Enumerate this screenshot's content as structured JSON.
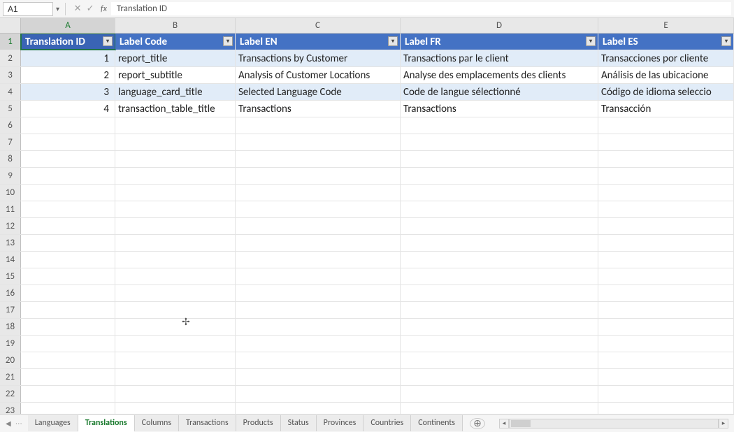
{
  "namebox": "A1",
  "formula_bar": "Translation ID",
  "columns": [
    "A",
    "B",
    "C",
    "D",
    "E"
  ],
  "selected_column": "A",
  "selected_row": 1,
  "row_numbers": [
    1,
    2,
    3,
    4,
    5,
    6,
    7,
    8,
    9,
    10,
    11,
    12,
    13,
    14,
    15,
    16,
    17,
    18,
    19,
    20,
    21,
    22,
    23
  ],
  "headers": {
    "A": "Translation ID",
    "B": "Label Code",
    "C": "Label EN",
    "D": "Label FR",
    "E": "Label ES"
  },
  "rows": [
    {
      "A": "1",
      "B": "report_title",
      "C": "Transactions by Customer",
      "D": "Transactions par le client",
      "E": "Transacciones por cliente"
    },
    {
      "A": "2",
      "B": "report_subtitle",
      "C": "Analysis of Customer Locations",
      "D": "Analyse des emplacements des clients",
      "E": "Análisis de las ubicacione"
    },
    {
      "A": "3",
      "B": "language_card_title",
      "C": "Selected Language Code",
      "D": "Code de langue sélectionné",
      "E": "Código de idioma seleccio"
    },
    {
      "A": "4",
      "B": "transaction_table_title",
      "C": "Transactions",
      "D": "Transactions",
      "E": "Transacción"
    }
  ],
  "tabs": [
    "Languages",
    "Translations",
    "Columns",
    "Transactions",
    "Products",
    "Status",
    "Provinces",
    "Countries",
    "Continents"
  ],
  "active_tab": "Translations",
  "icons": {
    "cancel": "✕",
    "enter": "✓",
    "fx": "fx",
    "filter": "▾",
    "add": "⊕",
    "nav_first": "◀",
    "nav_ellipsis": "⋯",
    "nav_left": "◂",
    "nav_right": "▸"
  }
}
